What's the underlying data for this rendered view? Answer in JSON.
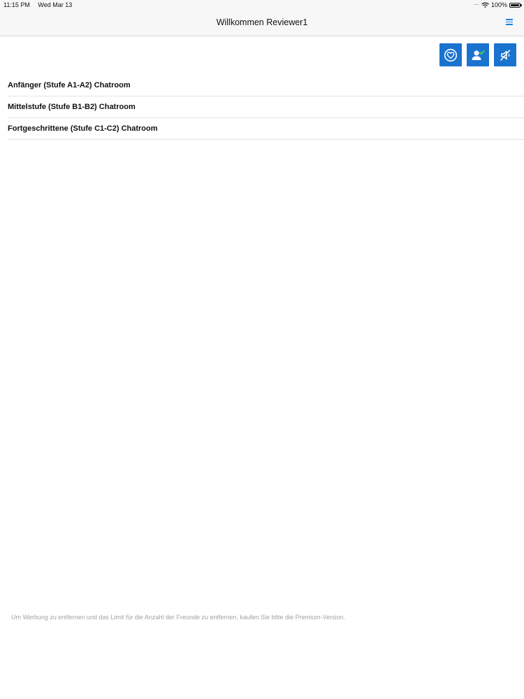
{
  "status_bar": {
    "time": "11:15 PM",
    "date": "Wed Mar 13",
    "battery": "100%"
  },
  "nav": {
    "title": "Willkommen Reviewer1",
    "menu_icon": "hamburger-menu-icon",
    "accent_color": "#1f7fd9"
  },
  "actions": [
    {
      "name": "favorites",
      "icon": "heart-circle-icon"
    },
    {
      "name": "accepted-users",
      "icon": "user-check-icon"
    },
    {
      "name": "mute",
      "icon": "mute-icon"
    }
  ],
  "action_color": "#1a73cf",
  "chatrooms": [
    {
      "label": "Anfänger (Stufe A1-A2) Chatroom"
    },
    {
      "label": "Mittelstufe (Stufe B1-B2) Chatroom"
    },
    {
      "label": "Fortgeschrittene (Stufe C1-C2) Chatroom"
    }
  ],
  "footer": {
    "note": "Um Werbung zu entfernen und das Limit für die Anzahl der Freunde zu entfernen, kaufen Sie bitte die Premium-Version."
  }
}
